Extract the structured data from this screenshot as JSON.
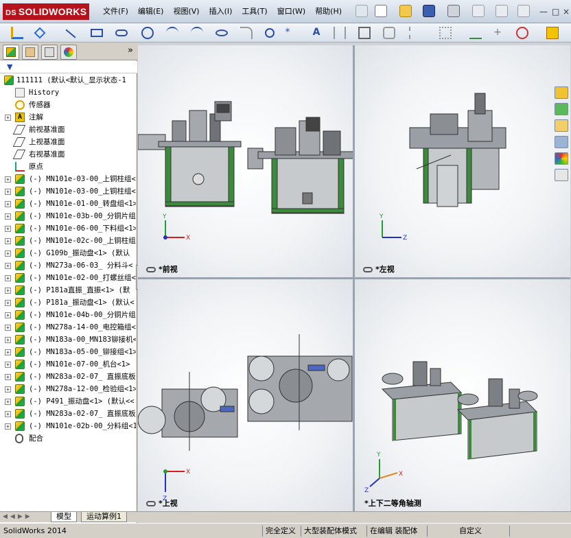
{
  "app": {
    "brand": "SOLIDWORKS",
    "brand_prefix": "DS"
  },
  "menu": [
    "文件(F)",
    "编辑(E)",
    "视图(V)",
    "插入(I)",
    "工具(T)",
    "窗口(W)",
    "帮助(H)"
  ],
  "panel": {
    "collapse_glyph": "»",
    "tree": [
      {
        "label": "111111  (默认<默认_显示状态-1",
        "icon": "part",
        "expand": false
      },
      {
        "label": "History",
        "icon": "history",
        "expand": false
      },
      {
        "label": "传感器",
        "icon": "sensor",
        "expand": false
      },
      {
        "label": "注解",
        "icon": "note",
        "expand": true
      },
      {
        "label": "前视基准面",
        "icon": "plane",
        "expand": false
      },
      {
        "label": "上视基准面",
        "icon": "plane",
        "expand": false
      },
      {
        "label": "右视基准面",
        "icon": "plane",
        "expand": false
      },
      {
        "label": "原点",
        "icon": "origin",
        "expand": false
      },
      {
        "label": "(-) MN101e-03-00_上铜柱组<",
        "icon": "part",
        "expand": true
      },
      {
        "label": "(-) MN101e-03-00_上铜柱组<",
        "icon": "part",
        "expand": true
      },
      {
        "label": "(-) MN101e-01-00_转盘组<1>",
        "icon": "part",
        "expand": true
      },
      {
        "label": "(-) MN101e-03b-00_分铜片组",
        "icon": "part",
        "expand": true
      },
      {
        "label": "(-) MN101e-06-00_下料组<1>",
        "icon": "part",
        "expand": true
      },
      {
        "label": "(-) MN101e-02c-00_上铜柱组",
        "icon": "part",
        "expand": true
      },
      {
        "label": "(-) G109b_振动盘<1> (默认",
        "icon": "part",
        "expand": true
      },
      {
        "label": "(-) MN273a-06-03_ 分料斗<",
        "icon": "part",
        "expand": true
      },
      {
        "label": "(-) MN101e-02-00_打螺丝组<",
        "icon": "part",
        "expand": true
      },
      {
        "label": "(-) P181a直振_直振<1> (默",
        "icon": "part",
        "expand": true
      },
      {
        "label": "(-) P181a_振动盘<1> (默认<",
        "icon": "part",
        "expand": true
      },
      {
        "label": "(-) MN101e-04b-00_分铜片组",
        "icon": "part",
        "expand": true
      },
      {
        "label": "(-) MN278a-14-00_电控箱组<",
        "icon": "part",
        "expand": true
      },
      {
        "label": "(-) MN183a-00_MN183铆接机<",
        "icon": "part",
        "expand": true
      },
      {
        "label": "(-) MN183a-05-00_铆接组<1>",
        "icon": "part",
        "expand": true
      },
      {
        "label": "(-) MN101e-07-00_机台<1> (",
        "icon": "part",
        "expand": true
      },
      {
        "label": "(-) MN283a-02-07_ 直振底板",
        "icon": "part",
        "expand": true
      },
      {
        "label": "(-) MN278a-12-00_检验组<1>",
        "icon": "part",
        "expand": true
      },
      {
        "label": "(-) P491_振动盘<1> (默认<<",
        "icon": "part",
        "expand": true
      },
      {
        "label": "(-) MN283a-02-07_ 直振底板",
        "icon": "part",
        "expand": true
      },
      {
        "label": "(-) MN101e-02b-00_分料组<1",
        "icon": "part",
        "expand": true
      },
      {
        "label": "配合",
        "icon": "mate",
        "expand": false
      }
    ]
  },
  "bottom_tabs": [
    "模型",
    "运动算例1"
  ],
  "viewports": [
    {
      "label": "*前视",
      "axes": [
        "Y",
        "X"
      ]
    },
    {
      "label": "*左视",
      "axes": [
        "Y",
        "Z"
      ]
    },
    {
      "label": "*上视",
      "axes": [
        "Z",
        "X"
      ]
    },
    {
      "label": "*上下二等角轴测",
      "axes": [
        "Y",
        "X",
        "Z"
      ]
    }
  ],
  "status": {
    "app_version": "SolidWorks 2014",
    "fully_defined": "完全定义",
    "large_assembly": "大型装配体模式",
    "editing": "在编辑 装配体",
    "custom": "自定义"
  },
  "colors": {
    "brand_red": "#b5121b",
    "frame_green": "#3c8a3c",
    "machine_gray": "#9a9fa5",
    "axis_x": "#d02020",
    "axis_y": "#20a030",
    "axis_z": "#2030c0"
  }
}
